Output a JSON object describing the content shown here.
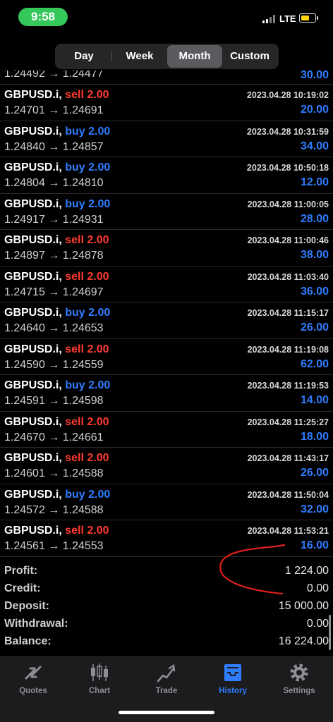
{
  "status": {
    "time": "9:58",
    "network": "LTE"
  },
  "periods": [
    {
      "label": "Day",
      "active": false
    },
    {
      "label": "Week",
      "active": false
    },
    {
      "label": "Month",
      "active": true
    },
    {
      "label": "Custom",
      "active": false
    }
  ],
  "partial_row": {
    "prices": "1.24492 → 1.24477",
    "profit": "30.00"
  },
  "deals": [
    {
      "symbol": "GBPUSD.i,",
      "type": "sell",
      "volume": "sell 2.00",
      "prices": "1.24701 → 1.24691",
      "datetime": "2023.04.28 10:19:02",
      "profit": "20.00"
    },
    {
      "symbol": "GBPUSD.i,",
      "type": "buy",
      "volume": "buy 2.00",
      "prices": "1.24840 → 1.24857",
      "datetime": "2023.04.28 10:31:59",
      "profit": "34.00"
    },
    {
      "symbol": "GBPUSD.i,",
      "type": "buy",
      "volume": "buy 2.00",
      "prices": "1.24804 → 1.24810",
      "datetime": "2023.04.28 10:50:18",
      "profit": "12.00"
    },
    {
      "symbol": "GBPUSD.i,",
      "type": "buy",
      "volume": "buy 2.00",
      "prices": "1.24917 → 1.24931",
      "datetime": "2023.04.28 11:00:05",
      "profit": "28.00"
    },
    {
      "symbol": "GBPUSD.i,",
      "type": "sell",
      "volume": "sell 2.00",
      "prices": "1.24897 → 1.24878",
      "datetime": "2023.04.28 11:00:46",
      "profit": "38.00"
    },
    {
      "symbol": "GBPUSD.i,",
      "type": "sell",
      "volume": "sell 2.00",
      "prices": "1.24715 → 1.24697",
      "datetime": "2023.04.28 11:03:40",
      "profit": "36.00"
    },
    {
      "symbol": "GBPUSD.i,",
      "type": "buy",
      "volume": "buy 2.00",
      "prices": "1.24640 → 1.24653",
      "datetime": "2023.04.28 11:15:17",
      "profit": "26.00"
    },
    {
      "symbol": "GBPUSD.i,",
      "type": "sell",
      "volume": "sell 2.00",
      "prices": "1.24590 → 1.24559",
      "datetime": "2023.04.28 11:19:08",
      "profit": "62.00"
    },
    {
      "symbol": "GBPUSD.i,",
      "type": "buy",
      "volume": "buy 2.00",
      "prices": "1.24591 → 1.24598",
      "datetime": "2023.04.28 11:19:53",
      "profit": "14.00"
    },
    {
      "symbol": "GBPUSD.i,",
      "type": "sell",
      "volume": "sell 2.00",
      "prices": "1.24670 → 1.24661",
      "datetime": "2023.04.28 11:25:27",
      "profit": "18.00"
    },
    {
      "symbol": "GBPUSD.i,",
      "type": "sell",
      "volume": "sell 2.00",
      "prices": "1.24601 → 1.24588",
      "datetime": "2023.04.28 11:43:17",
      "profit": "26.00"
    },
    {
      "symbol": "GBPUSD.i,",
      "type": "buy",
      "volume": "buy 2.00",
      "prices": "1.24572 → 1.24588",
      "datetime": "2023.04.28 11:50:04",
      "profit": "32.00"
    },
    {
      "symbol": "GBPUSD.i,",
      "type": "sell",
      "volume": "sell 2.00",
      "prices": "1.24561 → 1.24553",
      "datetime": "2023.04.28 11:53:21",
      "profit": "16.00"
    }
  ],
  "summary": [
    {
      "label": "Profit:",
      "value": "1 224.00"
    },
    {
      "label": "Credit:",
      "value": "0.00"
    },
    {
      "label": "Deposit:",
      "value": "15 000.00"
    },
    {
      "label": "Withdrawal:",
      "value": "0.00"
    },
    {
      "label": "Balance:",
      "value": "16 224.00"
    }
  ],
  "tabs": [
    {
      "label": "Quotes",
      "icon": "quotes-icon",
      "active": false
    },
    {
      "label": "Chart",
      "icon": "chart-icon",
      "active": false
    },
    {
      "label": "Trade",
      "icon": "trade-icon",
      "active": false
    },
    {
      "label": "History",
      "icon": "history-icon",
      "active": true
    },
    {
      "label": "Settings",
      "icon": "settings-icon",
      "active": false
    }
  ],
  "colors": {
    "sell": "#ff3b30",
    "buy": "#2f7dff",
    "profit": "#2f7dff",
    "active_tab": "#2f7dff",
    "inactive_tab": "#8e8e93",
    "status_pill": "#34c759",
    "annotation": "#e0201b"
  }
}
